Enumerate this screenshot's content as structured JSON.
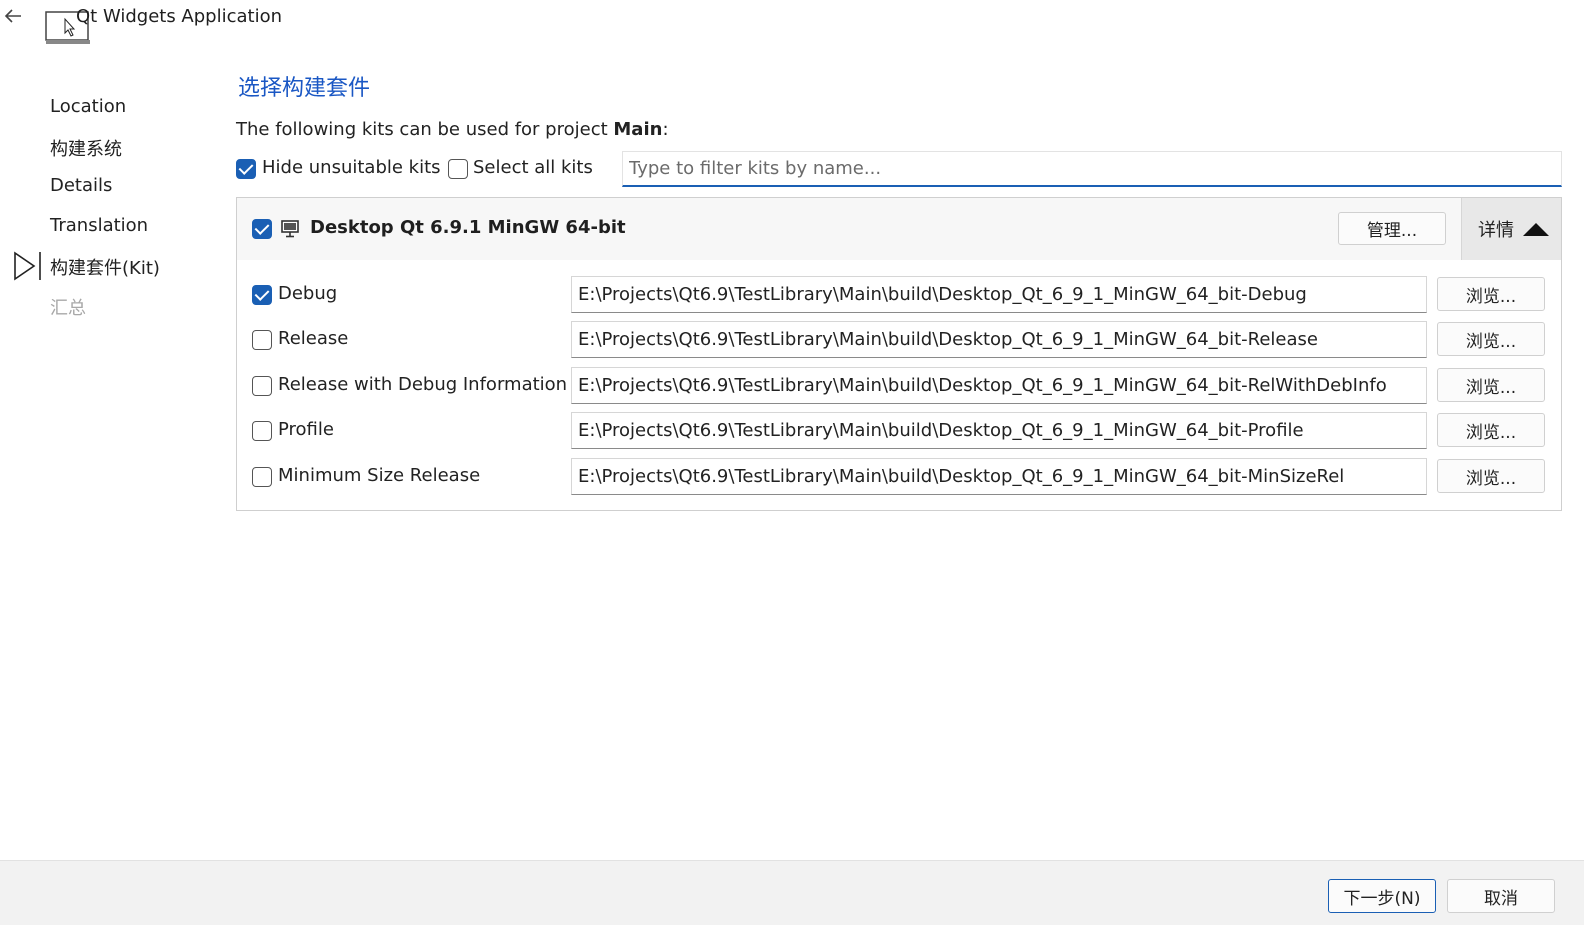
{
  "window": {
    "title": "Qt Widgets Application"
  },
  "sidebar": {
    "steps": [
      {
        "label": "Location"
      },
      {
        "label": "构建系统"
      },
      {
        "label": "Details"
      },
      {
        "label": "Translation"
      },
      {
        "label": "构建套件(Kit)",
        "current": true
      },
      {
        "label": "汇总",
        "disabled": true
      }
    ]
  },
  "main": {
    "heading": "选择构建套件",
    "intro_prefix": "The following kits can be used for project ",
    "project_name": "Main",
    "intro_suffix": ":",
    "hide_unsuitable": {
      "label": "Hide unsuitable kits",
      "checked": true
    },
    "select_all": {
      "label": "Select all kits",
      "checked": false
    },
    "filter": {
      "placeholder": "Type to filter kits by name...",
      "value": ""
    }
  },
  "kit": {
    "name": "Desktop Qt 6.9.1 MinGW 64-bit",
    "checked": true,
    "manage_label": "管理...",
    "details_label": "详情",
    "configs": [
      {
        "label": "Debug",
        "checked": true,
        "path": "E:\\Projects\\Qt6.9\\TestLibrary\\Main\\build\\Desktop_Qt_6_9_1_MinGW_64_bit-Debug",
        "browse": "浏览..."
      },
      {
        "label": "Release",
        "checked": false,
        "path": "E:\\Projects\\Qt6.9\\TestLibrary\\Main\\build\\Desktop_Qt_6_9_1_MinGW_64_bit-Release",
        "browse": "浏览..."
      },
      {
        "label": "Release with Debug Information",
        "checked": false,
        "path": "E:\\Projects\\Qt6.9\\TestLibrary\\Main\\build\\Desktop_Qt_6_9_1_MinGW_64_bit-RelWithDebInfo",
        "browse": "浏览..."
      },
      {
        "label": "Profile",
        "checked": false,
        "path": "E:\\Projects\\Qt6.9\\TestLibrary\\Main\\build\\Desktop_Qt_6_9_1_MinGW_64_bit-Profile",
        "browse": "浏览..."
      },
      {
        "label": "Minimum Size Release",
        "checked": false,
        "path": "E:\\Projects\\Qt6.9\\TestLibrary\\Main\\build\\Desktop_Qt_6_9_1_MinGW_64_bit-MinSizeRel",
        "browse": "浏览..."
      }
    ]
  },
  "footer": {
    "next_label": "下一步(N)",
    "cancel_label": "取消"
  },
  "colors": {
    "accent": "#1a5fb4",
    "heading": "#1a57c4",
    "disabled_text": "#a8a8a8",
    "footer_bg": "#f2f2f2"
  },
  "icons": {
    "back": "back-arrow-icon",
    "app": "app-window-icon",
    "step_marker": "current-step-arrow-icon",
    "kit": "monitor-icon",
    "details_toggle": "triangle-up-icon"
  }
}
